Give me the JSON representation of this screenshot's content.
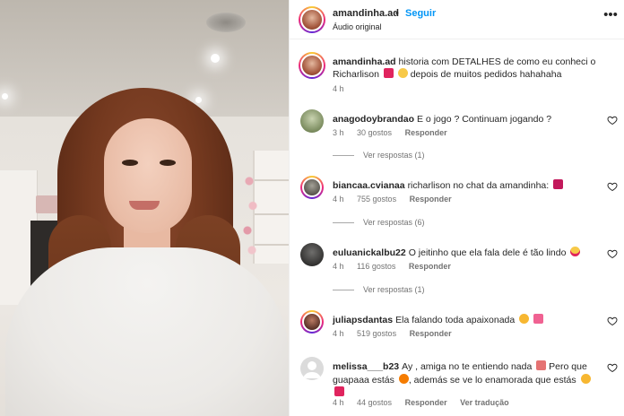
{
  "header": {
    "username": "amandinha.ad",
    "separator": "•",
    "follow_label": "Seguir",
    "subtitle": "Áudio original",
    "more_icon": "more-horizontal-icon"
  },
  "caption": {
    "username": "amandinha.ad",
    "text": "historia com DETALHES de como eu conheci o Richarlison",
    "text_after": "depois de muitos pedidos hahahaha",
    "time": "4 h"
  },
  "comments": [
    {
      "username": "anagodoybrandao",
      "text": "E o jogo ? Continuam jogando ?",
      "time": "3 h",
      "likes": "30 gostos",
      "reply": "Responder",
      "view_replies": "Ver respostas (1)"
    },
    {
      "username": "biancaa.cvianaa",
      "text": "richarlison no chat da amandinha:",
      "time": "4 h",
      "likes": "755 gostos",
      "reply": "Responder",
      "view_replies": "Ver respostas (6)"
    },
    {
      "username": "euluanickalbu22",
      "text": "O jeitinho que ela fala dele é tão lindo",
      "time": "4 h",
      "likes": "116 gostos",
      "reply": "Responder",
      "view_replies": "Ver respostas (1)"
    },
    {
      "username": "juliapsdantas",
      "text": "Ela falando toda apaixonada",
      "time": "4 h",
      "likes": "519 gostos",
      "reply": "Responder"
    },
    {
      "username": "melissa___b23",
      "text": "Ay , amiga no te entiendo nada",
      "text2": "Pero que guapaaa estás",
      "text3": ", además se ve lo enamorada que estás",
      "time": "4 h",
      "likes": "44 gostos",
      "reply": "Responder",
      "translate": "Ver tradução"
    }
  ],
  "colors": {
    "follow": "#0095f6",
    "text": "#262626",
    "muted": "#737373"
  }
}
